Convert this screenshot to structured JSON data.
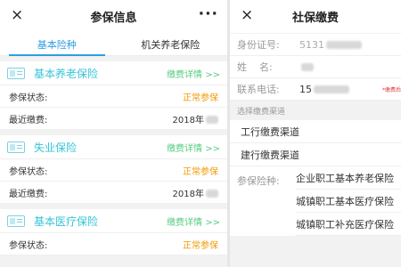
{
  "left": {
    "nav": {
      "close_icon": "×",
      "title": "参保信息",
      "more_icon": "···"
    },
    "tabs": [
      "基本险种",
      "机关养老保险"
    ],
    "cards": [
      {
        "title": "基本养老保险",
        "detail": "缴费详情 >>",
        "rows": [
          {
            "label": "参保状态:",
            "value": "正常参保",
            "highlight": true
          },
          {
            "label": "最近缴费:",
            "value": "2018年",
            "highlight": false
          }
        ]
      },
      {
        "title": "失业保险",
        "detail": "缴费详情 >>",
        "rows": [
          {
            "label": "参保状态:",
            "value": "正常参保",
            "highlight": true
          },
          {
            "label": "最近缴费:",
            "value": "2018年",
            "highlight": false
          }
        ]
      },
      {
        "title": "基本医疗保险",
        "detail": "缴费详情 >>",
        "rows": [
          {
            "label": "参保状态:",
            "value": "正常参保",
            "highlight": true
          }
        ]
      }
    ]
  },
  "right": {
    "nav": {
      "close_icon": "×",
      "title": "社保缴费"
    },
    "fields": [
      {
        "label": "身份证号:",
        "value": "5131"
      },
      {
        "label": "姓    名:",
        "value": ""
      },
      {
        "label": "联系电话:",
        "value": "15",
        "note": "*缴费后"
      }
    ],
    "section_label": "选择缴费渠道",
    "channels": [
      "工行缴费渠道",
      "建行缴费渠道"
    ],
    "insurance_type": {
      "label": "参保险种:",
      "options": [
        "企业职工基本养老保险",
        "城镇职工基本医疗保险",
        "城镇职工补充医疗保险"
      ]
    }
  },
  "colors": {
    "tab_active": "#2f9de0",
    "card_title": "#34c4d8",
    "detail_link": "#56cc80",
    "status": "#f39800"
  }
}
